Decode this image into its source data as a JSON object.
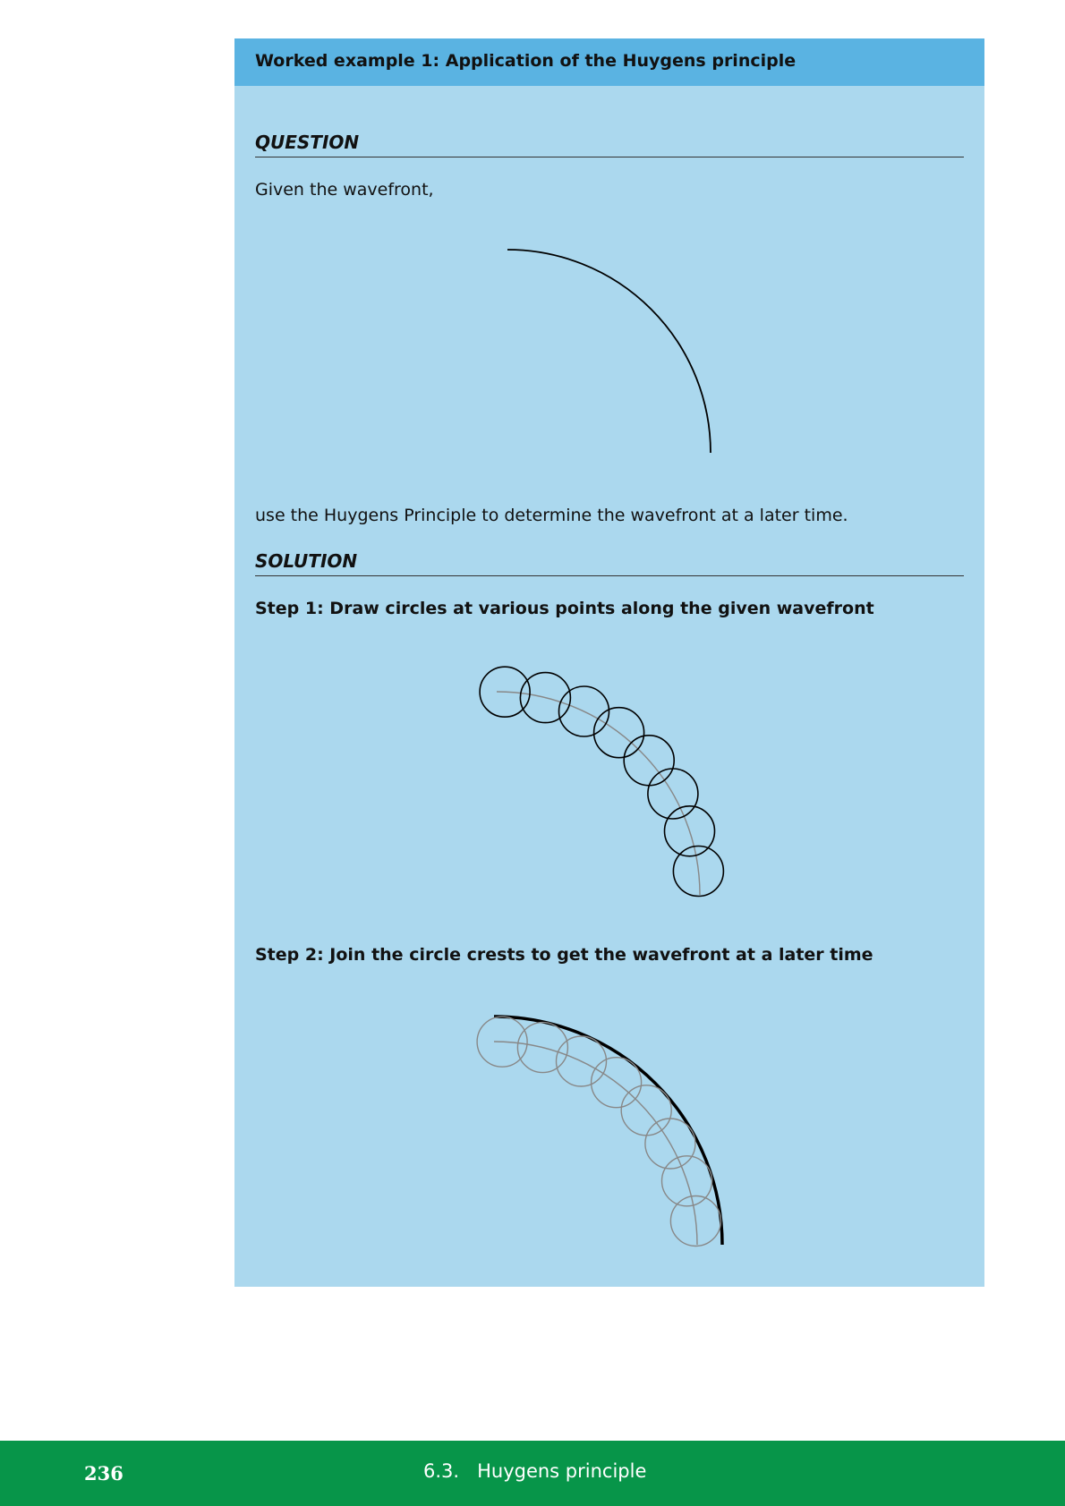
{
  "worked_example": {
    "title": "Worked example 1:  Application of the Huygens principle",
    "question_heading": "QUESTION",
    "question_text": "Given the wavefront,",
    "question_continuation": "use the Huygens Principle to determine the wavefront at a later time.",
    "solution_heading": "SOLUTION",
    "step1": "Step 1: Draw circles at various points along the given wavefront",
    "step2": "Step 2: Join the circle crests to get the wavefront at a later time"
  },
  "footer": {
    "page_number": "236",
    "section": "6.3.   Huygens principle"
  },
  "colors": {
    "box_background": "#abd8ee",
    "box_header": "#5ab3e2",
    "footer_background": "#079549",
    "original_wavefront_gray": "#888888"
  }
}
